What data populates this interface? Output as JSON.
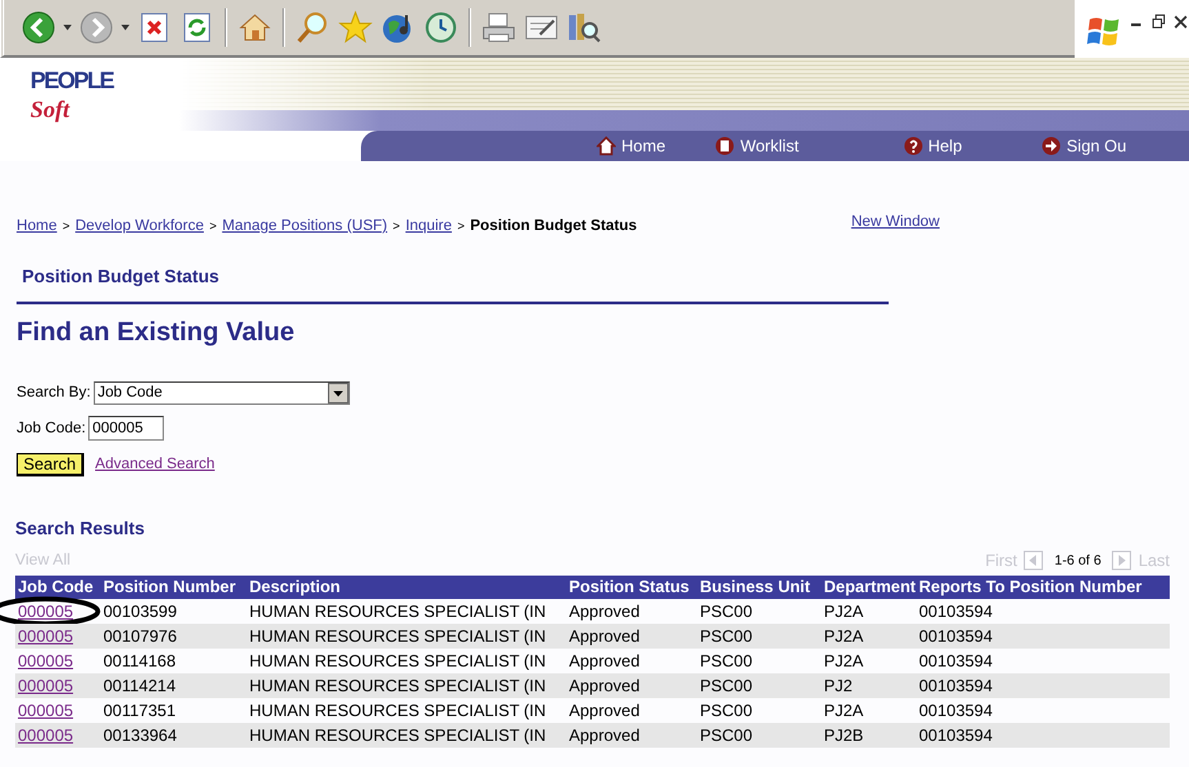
{
  "browser_toolbar": {
    "buttons": [
      {
        "kind": "back"
      },
      {
        "kind": "forward"
      },
      {
        "kind": "stop"
      },
      {
        "kind": "refresh"
      },
      {
        "kind": "home"
      },
      {
        "kind": "search"
      },
      {
        "kind": "favorites"
      },
      {
        "kind": "media"
      },
      {
        "kind": "history"
      },
      {
        "kind": "print"
      },
      {
        "kind": "edit"
      },
      {
        "kind": "research"
      }
    ]
  },
  "logo": {
    "top": "PEOPLE",
    "bottom": "Soft"
  },
  "nav": [
    {
      "kind": "home",
      "label": "Home"
    },
    {
      "kind": "worklist",
      "label": "Worklist"
    },
    {
      "kind": "help",
      "label": "Help"
    },
    {
      "kind": "signout",
      "label": "Sign Ou"
    }
  ],
  "breadcrumb": [
    {
      "kind": "link",
      "text": "Home"
    },
    {
      "kind": "sep",
      "text": ">"
    },
    {
      "kind": "link",
      "text": "Develop Workforce"
    },
    {
      "kind": "sep",
      "text": ">"
    },
    {
      "kind": "link",
      "text": "Manage Positions (USF)"
    },
    {
      "kind": "sep",
      "text": ">"
    },
    {
      "kind": "link",
      "text": "Inquire"
    },
    {
      "kind": "sep",
      "text": ">"
    },
    {
      "kind": "current",
      "text": "Position Budget Status"
    }
  ],
  "new_window": "New Window",
  "page_title": "Position Budget Status",
  "heading": "Find an Existing Value",
  "search_by": {
    "label": "Search By:",
    "value": "Job Code"
  },
  "job_code": {
    "label": "Job Code:",
    "value": "000005"
  },
  "search_button": "Search",
  "advanced_search": "Advanced Search",
  "results": {
    "title": "Search Results",
    "view_all": {
      "label": "View All",
      "disabled": true
    },
    "pager": {
      "first": {
        "label": "First",
        "disabled": true
      },
      "range": "1-6 of 6",
      "last": {
        "label": "Last",
        "disabled": true
      }
    },
    "columns": [
      "Job Code",
      "Position Number",
      "Description",
      "Position Status",
      "Business Unit",
      "Department",
      "Reports To Position Number"
    ],
    "rows": [
      {
        "circled": true,
        "cells": [
          "000005",
          "00103599",
          "HUMAN RESOURCES SPECIALIST (IN",
          "Approved",
          "PSC00",
          "PJ2A",
          "00103594"
        ]
      },
      {
        "circled": false,
        "cells": [
          "000005",
          "00107976",
          "HUMAN RESOURCES SPECIALIST (IN",
          "Approved",
          "PSC00",
          "PJ2A",
          "00103594"
        ]
      },
      {
        "circled": false,
        "cells": [
          "000005",
          "00114168",
          "HUMAN RESOURCES SPECIALIST (IN",
          "Approved",
          "PSC00",
          "PJ2A",
          "00103594"
        ]
      },
      {
        "circled": false,
        "cells": [
          "000005",
          "00114214",
          "HUMAN RESOURCES SPECIALIST (IN",
          "Approved",
          "PSC00",
          "PJ2",
          "00103594"
        ]
      },
      {
        "circled": false,
        "cells": [
          "000005",
          "00117351",
          "HUMAN RESOURCES SPECIALIST (IN",
          "Approved",
          "PSC00",
          "PJ2A",
          "00103594"
        ]
      },
      {
        "circled": false,
        "cells": [
          "000005",
          "00133964",
          "HUMAN RESOURCES SPECIALIST (IN",
          "Approved",
          "PSC00",
          "PJ2B",
          "00103594"
        ]
      }
    ]
  }
}
